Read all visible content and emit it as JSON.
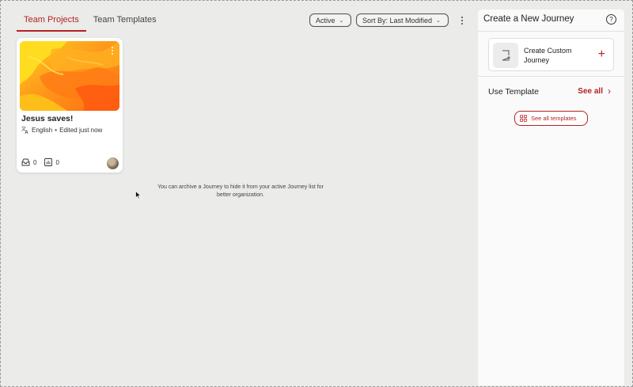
{
  "tabs": [
    {
      "label": "Team Projects",
      "active": true
    },
    {
      "label": "Team Templates",
      "active": false
    }
  ],
  "filters": {
    "status_label": "Active",
    "sort_label": "Sort By: Last Modified"
  },
  "journey_card": {
    "title": "Jesus saves!",
    "language": "English",
    "separator": "•",
    "edited": "Edited just now",
    "responses_count": "0",
    "visitors_count": "0"
  },
  "hint_text": "You can archive a Journey to hide it from your active Journey list for better organization.",
  "panel": {
    "title": "Create a New Journey",
    "help_glyph": "?",
    "custom_label": "Create Custom Journey",
    "plus_glyph": "+",
    "use_template": "Use Template",
    "see_all": "See all",
    "see_all_chevron": "›",
    "see_all_templates": "See all templates"
  },
  "colors": {
    "accent": "#b42222",
    "background": "#ebebe9",
    "panel": "#fafafa"
  }
}
